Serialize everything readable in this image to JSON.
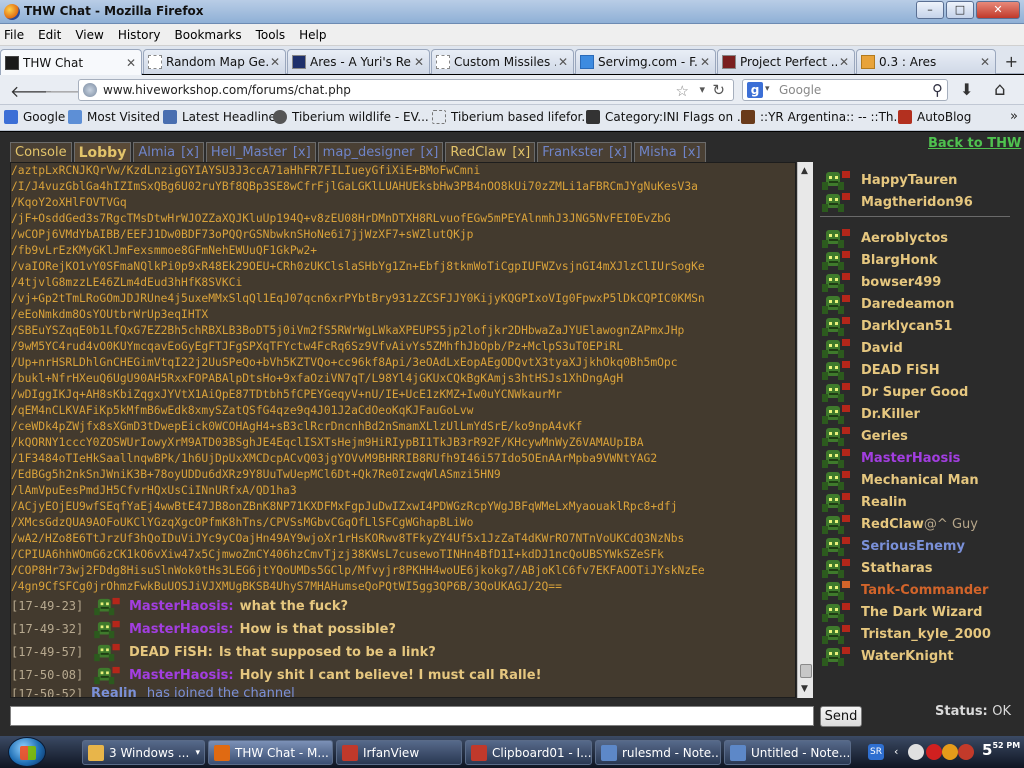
{
  "window": {
    "title": "THW Chat - Mozilla Firefox",
    "buttons": [
      "–",
      "□",
      "✕"
    ]
  },
  "menu": [
    "File",
    "Edit",
    "View",
    "History",
    "Bookmarks",
    "Tools",
    "Help"
  ],
  "tabs": [
    {
      "label": "THW Chat",
      "active": true
    },
    {
      "label": "Random Map Ge...",
      "active": false
    },
    {
      "label": "Ares - A Yuri's Re...",
      "active": false
    },
    {
      "label": "Custom Missiles ...",
      "active": false
    },
    {
      "label": "Servimg.com - F...",
      "active": false
    },
    {
      "label": "Project Perfect ...",
      "active": false
    },
    {
      "label": "0.3 : Ares",
      "active": false
    }
  ],
  "nav": {
    "url": "www.hiveworkshop.com/forums/chat.php",
    "search_placeholder": "Google"
  },
  "bookmarks": [
    "Google",
    "Most Visited",
    "Latest Headlines",
    "Tiberium wildlife - EV...",
    "Tiberium based lifefor...",
    "Category:INI Flags on ...",
    "::YR Argentina:: -- ::Th...",
    "AutoBlog"
  ],
  "chat": {
    "room_tabs": [
      {
        "label": "Console",
        "closable": false
      },
      {
        "label": "Lobby",
        "closable": false
      },
      {
        "label": "Almia",
        "closable": true
      },
      {
        "label": "Hell_Master",
        "closable": true
      },
      {
        "label": "map_designer",
        "closable": true
      },
      {
        "label": "RedClaw",
        "closable": true
      },
      {
        "label": "Frankster",
        "closable": true
      },
      {
        "label": "Misha",
        "closable": true
      }
    ],
    "close_label": "[x]",
    "back_link": "Back to THW",
    "encoded_lines": [
      "/aztpLxRCNJKQrVw/KzdLnzigGYIAYSU3J3ccA71aHhFR7FILIueyGfiXiE+BMoFwCmni",
      "/I/J4vuzGblGa4hIZImSxQBg6U02ruYBf8QBp3SE8wCfrFjlGaLGKlLUAHUEksbHw3PB4nOO8kUi70zZMLi1aFBRCmJYgNuKesV3a",
      "/KqoY2oXHlFOVTVGq",
      "/jF+OsddGed3s7RgcTMsDtwHrWJOZZaXQJKluUp194Q+v8zEU08HrDMnDTXH8RLvuofEGw5mPEYAlnmhJ3JNG5NvFEI0EvZbG",
      "/wCOPj6VMdYbAIBB/EEFJ1Dw0BDF73oPQQrGSNbwknSHoNe6i7jjWzXF7+sWZlutQKjp",
      "/fb9vLrEzKMyGKlJmFexsmmoe8GFmNehEWUuQF1GkPw2+",
      "/vaIORejKO1vY0SFmaNQlkPi0p9xR48Ek29OEU+CRh0zUKClslaSHbYg1Zn+Ebfj8tkmWoTiCgpIUFWZvsjnGI4mXJlzClIUrSogKe",
      "/4tjvlG8mzzLE46ZLm4dEud3hHfK8SVKCi",
      "/vj+Gp2tTmLRoGOmJDJRUne4j5uxeMMxSlqQl1EqJ07qcn6xrPYbtBry931zZCSFJJY0KijyKQGPIxoVIg0FpwxP5lDkCQPIC0KMSn",
      "/eEoNmkdm8OsYOUtbrWrUp3eqIHTX",
      "/SBEuYSZqqE0b1LfQxG7EZ2Bh5chRBXLB3BoDT5j0iVm2fS5RWrWgLWkaXPEUPS5jp2lofjkr2DHbwaZaJYUElawognZAPmxJHp",
      "/9wM5YC4rud4vO0KUYmcqavEoGyEgFTJFgSPXqTFYctw4FcRq6Sz9VfvAivYs5ZMhfhJbOpb/Pz+MclpS3uT0EPiRL",
      "/Up+nrHSRLDhlGnCHEGimVtqI22j2UuSPeQo+bVh5KZTVQo+cc96kf8Api/3eOAdLxEopAEgODQvtX3tyaXJjkhOkq0Bh5mOpc",
      "/bukl+NfrHXeuQ6UgU90AH5RxxFOPABAlpDtsHo+9xfaOziVN7qT/L98Yl4jGKUxCQkBgKAmjs3htHSJs1XhDngAgH",
      "/wDIggIKJq+AH8sKbiZqgxJYVtX1AiQpE87TDtbh5fCPEYGeqyV+nU/IE+UcE1zKMZ+Iw0uYCNWkaurMr",
      "/qEM4nCLKVAFiKp5kMfmB6wEdk8xmySZatQSfG4qze9q4J01J2aCdOeoKqKJFauGoLvw",
      "/ceWDk4pZWjfx8sXGmD3tDwepEick0WCOHAgH4+sB3clRcrDncnhBd2nSmamXLlzUlLmYdSrE/ko9npA4vKf",
      "/kQORNY1cccY0ZOSWUrIowyXrM9ATD03BSghJE4EqclISXTsHejm9HiRIypBI1TkJB3rR92F/KHcywMnWyZ6VAMAUpIBA",
      "/1F3484oTIeHkSaallnqwBPk/1h6UjDpUxXMCDcpACvQ03jgYOVvM9BHRRIB8RUfh9I46i57Ido5OEnAArMpba9VWNtYAG2",
      "/EdBGg5h2nkSnJWniK3B+78oyUDDu6dXRz9Y8UuTwUepMCl6Dt+Qk7Re0IzwqWlASmzi5HN9",
      "/lAmVpuEesPmdJH5CfvrHQxUsCiINnURfxA/QD1ha3",
      "/ACjyEOjEU9wfSEqfYaEj4wwBtE47JB8onZBnK8NP71KXDFMxFgpJuDwIZxwI4PDWGzRcpYWgJBFqWMeLxMyaouaklRpc8+dfj",
      "/XMcsGdzQUA9AOFoUKClYGzqXgcOPfmK8hTns/CPVSsMGbvCGqOfLlSFCgWGhapBLiWo",
      "/wA2/HZo8E6TtJrzUf3hQoIDuViJYc9yCOajHn49AY9wjoXr1rHsKORwv8TFkyZY4Uf5x1JzZaT4dKWrRO7NTnVoUKCdQ3NzNbs",
      "/CPIUA6hhWOmG6zCK1kO6vXiw47x5CjmwoZmCY406hzCmvTjzj38KWsL7cusewoTINHn4BfD1I+kdDJ1ncQoUBSYWkSZeSFk",
      "/COP8Hr73wj2FDdg8HisuSlnWok0tHs3LEG6jtYQoUMDs5GClp/Mfvyjr8PKHH4woUE6jkokg7/ABjoKlC6fv7EKFAOOTiJYskNzEe",
      "/4gn9CfSFCg0jrOhmzFwkBuUOSJiVJXMUgBKSB4UhyS7MHAHumseQoPQtWI5gg3QP6B/3QoUKAGJ/2Q=="
    ],
    "messages": [
      {
        "time": "[17-49-23]",
        "nick": "MasterHaosis:",
        "nick_color": "#a23ee0",
        "text": "what the fuck?"
      },
      {
        "time": "[17-49-32]",
        "nick": "MasterHaosis:",
        "nick_color": "#a23ee0",
        "text": "How is that possible?"
      },
      {
        "time": "[17-49-57]",
        "nick": "DEAD FiSH:",
        "nick_color": "#e6c77f",
        "text": "Is that supposed to be a link?"
      },
      {
        "time": "[17-50-08]",
        "nick": "MasterHaosis:",
        "nick_color": "#a23ee0",
        "text": "Holy shit I cant believe! I must call Ralle!"
      }
    ],
    "join": {
      "time": "[17-50-52]",
      "nick": "Realin",
      "text": "has joined the channel"
    },
    "users_top": [
      {
        "name": "HappyTauren",
        "color": "#e6c77f",
        "suffix": ""
      },
      {
        "name": "Magtheridon96",
        "color": "#e6c77f",
        "suffix": ""
      }
    ],
    "users": [
      {
        "name": "Aeroblyctos",
        "color": "#e6c77f",
        "suffix": ""
      },
      {
        "name": "BlargHonk",
        "color": "#e6c77f",
        "suffix": ""
      },
      {
        "name": "bowser499",
        "color": "#e6c77f",
        "suffix": ""
      },
      {
        "name": "Daredeamon",
        "color": "#e6c77f",
        "suffix": ""
      },
      {
        "name": "Darklycan51",
        "color": "#e6c77f",
        "suffix": ""
      },
      {
        "name": "David",
        "color": "#e6c77f",
        "suffix": ""
      },
      {
        "name": "DEAD FiSH",
        "color": "#e6c77f",
        "suffix": ""
      },
      {
        "name": "Dr Super Good",
        "color": "#e6c77f",
        "suffix": ""
      },
      {
        "name": "Dr.Killer",
        "color": "#e6c77f",
        "suffix": ""
      },
      {
        "name": "Geries",
        "color": "#e6c77f",
        "suffix": ""
      },
      {
        "name": "MasterHaosis",
        "color": "#a23ee0",
        "suffix": ""
      },
      {
        "name": "Mechanical Man",
        "color": "#e6c77f",
        "suffix": ""
      },
      {
        "name": "Realin",
        "color": "#e6c77f",
        "suffix": ""
      },
      {
        "name": "RedClaw",
        "color": "#e6c77f",
        "suffix": "@^ Guy"
      },
      {
        "name": "SeriousEnemy",
        "color": "#7a90d8",
        "suffix": ""
      },
      {
        "name": "Statharas",
        "color": "#e6c77f",
        "suffix": ""
      },
      {
        "name": "Tank-Commander",
        "color": "#d2642a",
        "suffix": ""
      },
      {
        "name": "The Dark Wizard",
        "color": "#e6c77f",
        "suffix": ""
      },
      {
        "name": "Tristan_kyle_2000",
        "color": "#e6c77f",
        "suffix": ""
      },
      {
        "name": "WaterKnight",
        "color": "#e6c77f",
        "suffix": ""
      }
    ],
    "send_label": "Send",
    "status_label": "Status:",
    "status_value": "OK"
  },
  "taskbar": {
    "items": [
      {
        "label": "3 Windows ...",
        "icon": "folder-icon",
        "color": "#e8b54a"
      },
      {
        "label": "THW Chat - M...",
        "icon": "firefox-icon",
        "color": "#e06a12",
        "active": true
      },
      {
        "label": "IrfanView",
        "icon": "irfanview-icon",
        "color": "#c0392b"
      },
      {
        "label": "Clipboard01 - I...",
        "icon": "irfanview-icon",
        "color": "#c0392b"
      },
      {
        "label": "rulesmd - Note...",
        "icon": "notepad-icon",
        "color": "#5d88c8"
      },
      {
        "label": "Untitled - Note...",
        "icon": "notepad-icon",
        "color": "#5d88c8"
      }
    ],
    "clock": "5",
    "clock_sup": "52",
    "clock_ampm": "PM"
  },
  "colors": {
    "chat_bg": "#433a2e",
    "page_bg": "#2b2b2b",
    "code_text": "#d9a23a",
    "link_green": "#4fc24f"
  }
}
